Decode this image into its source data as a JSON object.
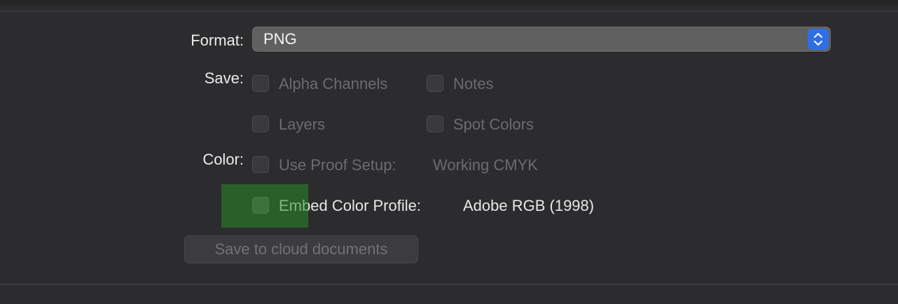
{
  "format": {
    "label": "Format:",
    "value": "PNG"
  },
  "save": {
    "label": "Save:",
    "options": [
      {
        "label": "Alpha Channels",
        "checked": false,
        "enabled": false
      },
      {
        "label": "Notes",
        "checked": false,
        "enabled": false
      },
      {
        "label": "Layers",
        "checked": false,
        "enabled": false
      },
      {
        "label": "Spot Colors",
        "checked": false,
        "enabled": false
      }
    ]
  },
  "color": {
    "label": "Color:",
    "proof_setup": {
      "label": "Use Proof Setup:",
      "value": "Working CMYK",
      "checked": false,
      "enabled": false
    },
    "embed_profile": {
      "label": "Embed Color Profile:",
      "value": "Adobe RGB (1998)",
      "checked": false,
      "enabled": true
    }
  },
  "cloud_button": {
    "label": "Save to cloud documents"
  },
  "colors": {
    "background": "#2c2c2e",
    "popup_accent": "#2f6fe6",
    "highlight": "#2f8a2f"
  },
  "icons": {
    "popup_arrows": "chevron-up-down-icon"
  }
}
